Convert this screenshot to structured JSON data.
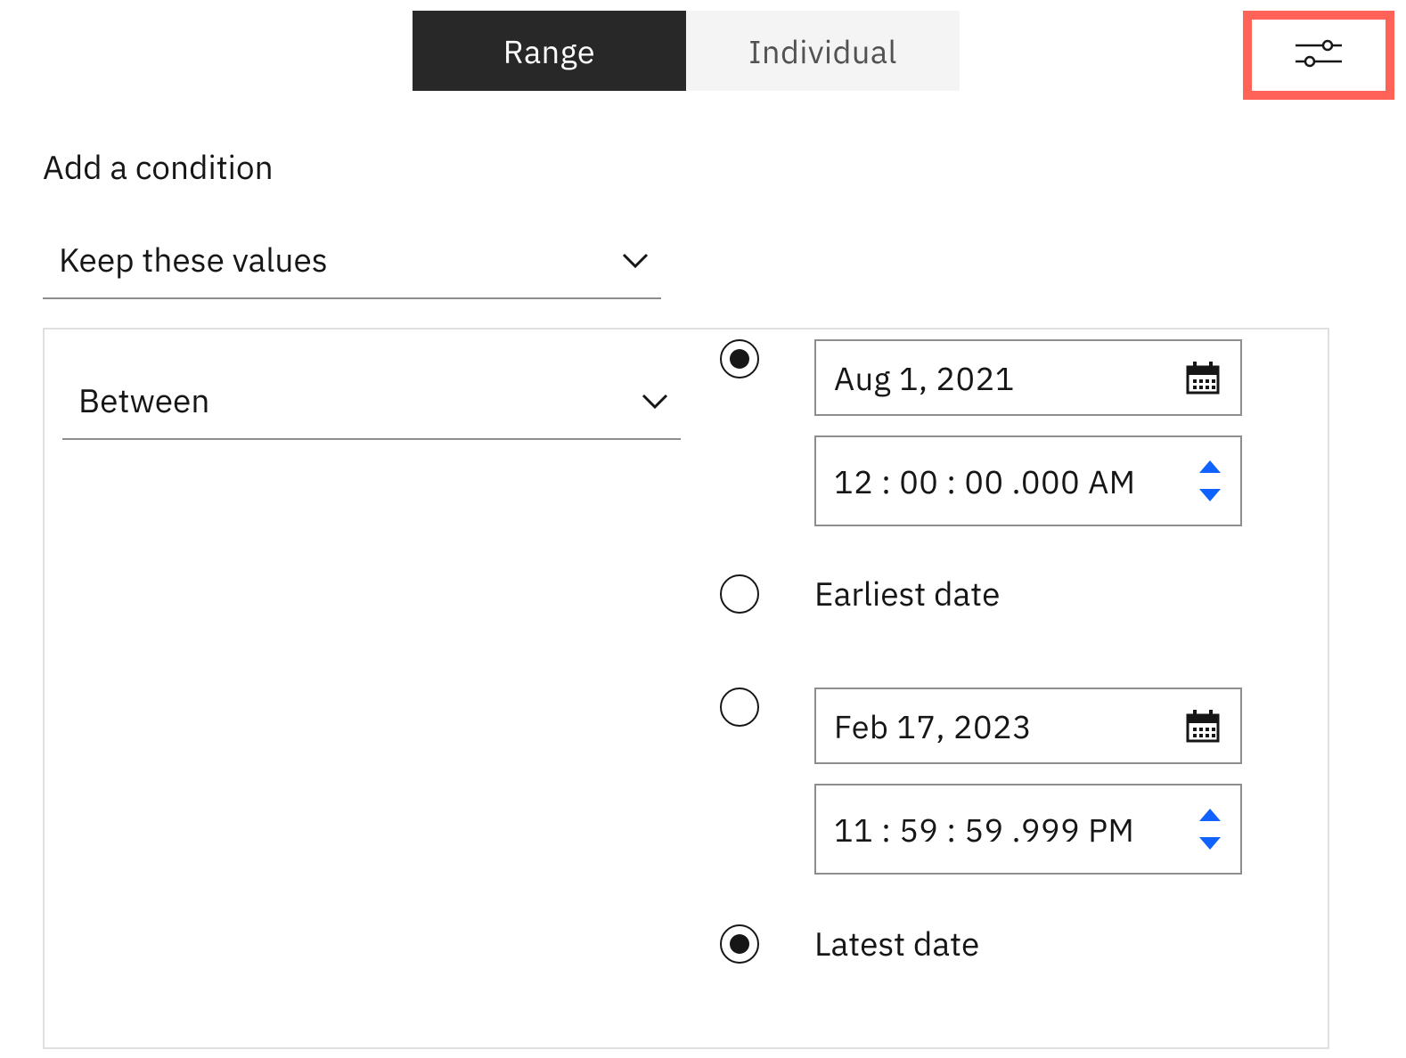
{
  "tabs": {
    "range": "Range",
    "individual": "Individual",
    "active": "range"
  },
  "section_label": "Add a condition",
  "condition_mode": {
    "selected": "Keep these values"
  },
  "range_operator": {
    "selected": "Between"
  },
  "start": {
    "mode": "specific",
    "date": "Aug 1, 2021",
    "time": "12 : 00 : 00 .000 AM",
    "earliest_label": "Earliest date"
  },
  "end": {
    "mode": "latest",
    "date": "Feb 17, 2023",
    "time": "11 : 59 : 59 .999 PM",
    "latest_label": "Latest date"
  }
}
